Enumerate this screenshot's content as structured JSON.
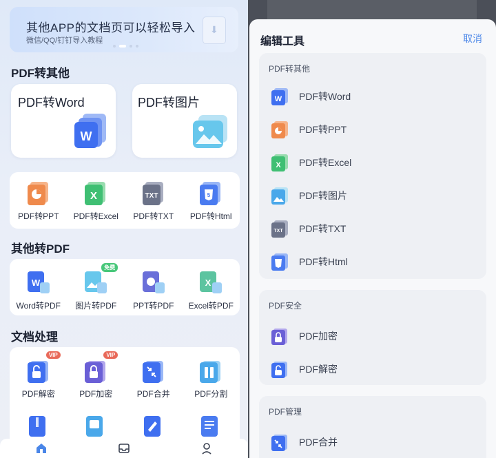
{
  "left": {
    "banner": {
      "title": "其他APP的文档页可以轻松导入",
      "subtitle": "微信/QQ/钉钉导入教程"
    },
    "sections": {
      "pdf_to_other": "PDF转其他",
      "other_to_pdf": "其他转PDF",
      "doc_process": "文档处理"
    },
    "big_cards": [
      {
        "label": "PDF转Word",
        "icon": "word-doc-icon"
      },
      {
        "label": "PDF转图片",
        "icon": "image-icon"
      }
    ],
    "pdf_to_other_tools": [
      {
        "label": "PDF转PPT",
        "icon": "ppt-icon"
      },
      {
        "label": "PDF转Excel",
        "icon": "excel-icon"
      },
      {
        "label": "PDF转TXT",
        "icon": "txt-icon"
      },
      {
        "label": "PDF转Html",
        "icon": "html-icon"
      }
    ],
    "other_to_pdf_tools": [
      {
        "label": "Word转PDF",
        "icon": "word-to-pdf-icon"
      },
      {
        "label": "图片转PDF",
        "icon": "image-to-pdf-icon",
        "badge": "免费"
      },
      {
        "label": "PPT转PDF",
        "icon": "ppt-to-pdf-icon"
      },
      {
        "label": "Excel转PDF",
        "icon": "excel-to-pdf-icon"
      }
    ],
    "doc_tools": [
      {
        "label": "PDF解密",
        "icon": "unlock-icon",
        "badge": "VIP"
      },
      {
        "label": "PDF加密",
        "icon": "lock-icon",
        "badge": "VIP"
      },
      {
        "label": "PDF合并",
        "icon": "merge-icon"
      },
      {
        "label": "PDF分割",
        "icon": "split-icon"
      }
    ],
    "nav": [
      {
        "icon": "home-icon"
      },
      {
        "icon": "inbox-icon"
      },
      {
        "icon": "profile-icon"
      }
    ]
  },
  "right": {
    "title": "编辑工具",
    "cancel": "取消",
    "groups": [
      {
        "title": "PDF转其他",
        "items": [
          {
            "label": "PDF转Word",
            "icon": "word-icon"
          },
          {
            "label": "PDF转PPT",
            "icon": "ppt-icon"
          },
          {
            "label": "PDF转Excel",
            "icon": "excel-icon"
          },
          {
            "label": "PDF转图片",
            "icon": "image-icon"
          },
          {
            "label": "PDF转TXT",
            "icon": "txt-icon"
          },
          {
            "label": "PDF转Html",
            "icon": "html-icon"
          }
        ]
      },
      {
        "title": "PDF安全",
        "items": [
          {
            "label": "PDF加密",
            "icon": "lock-icon"
          },
          {
            "label": "PDF解密",
            "icon": "unlock-icon"
          }
        ]
      },
      {
        "title": "PDF管理",
        "items": [
          {
            "label": "PDF合并",
            "icon": "merge-icon"
          }
        ]
      }
    ]
  },
  "colors": {
    "accent": "#4a86e8",
    "word": "#3f6ff0",
    "ppt": "#ef8a4c",
    "excel": "#3fbf73",
    "txt": "#6b7288",
    "html": "#4a7bf0",
    "vip": "#e96a5a",
    "free": "#48c77a"
  }
}
